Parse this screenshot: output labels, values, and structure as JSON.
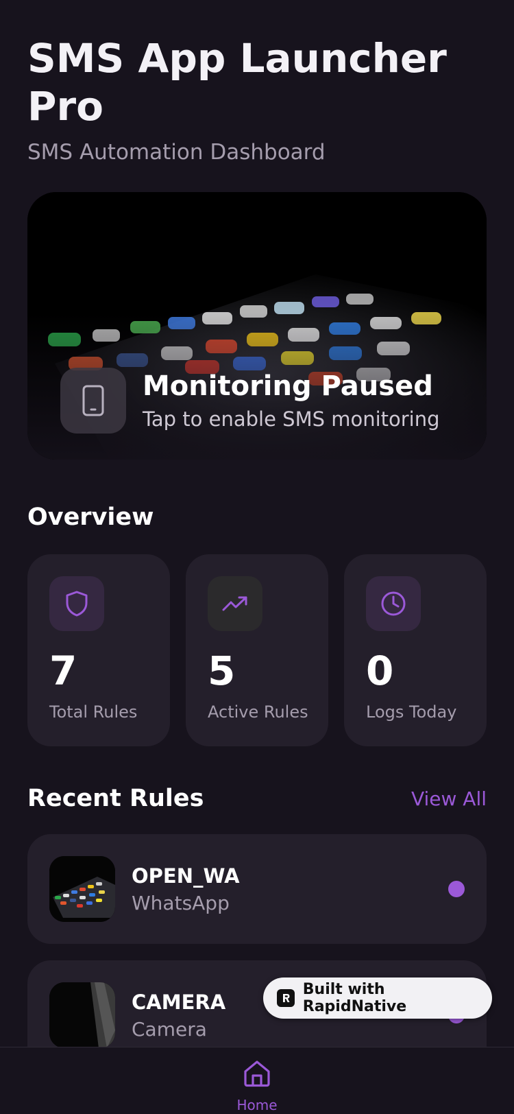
{
  "header": {
    "title": "SMS App Launcher Pro",
    "subtitle": "SMS Automation Dashboard"
  },
  "hero": {
    "icon": "smartphone-icon",
    "title": "Monitoring Paused",
    "subtitle": "Tap to enable SMS monitoring"
  },
  "overview": {
    "title": "Overview",
    "stats": [
      {
        "icon": "shield-icon",
        "value": "7",
        "label": "Total Rules",
        "color": "#9b59d8"
      },
      {
        "icon": "trending-up-icon",
        "value": "5",
        "label": "Active Rules",
        "color": "#9b59d8"
      },
      {
        "icon": "clock-icon",
        "value": "0",
        "label": "Logs Today",
        "color": "#9b59d8"
      }
    ]
  },
  "recent_rules": {
    "title": "Recent Rules",
    "view_all": "View All",
    "items": [
      {
        "name": "OPEN_WA",
        "app": "WhatsApp",
        "active": true
      },
      {
        "name": "CAMERA",
        "app": "Camera",
        "active": true
      }
    ]
  },
  "badge": {
    "text": "Built with RapidNative"
  },
  "nav": {
    "items": [
      {
        "label": "Home",
        "icon": "home-icon",
        "active": true
      }
    ]
  },
  "colors": {
    "background": "#17131d",
    "card": "#241f2b",
    "accent": "#9b59d8",
    "muted_text": "#a59dad"
  }
}
